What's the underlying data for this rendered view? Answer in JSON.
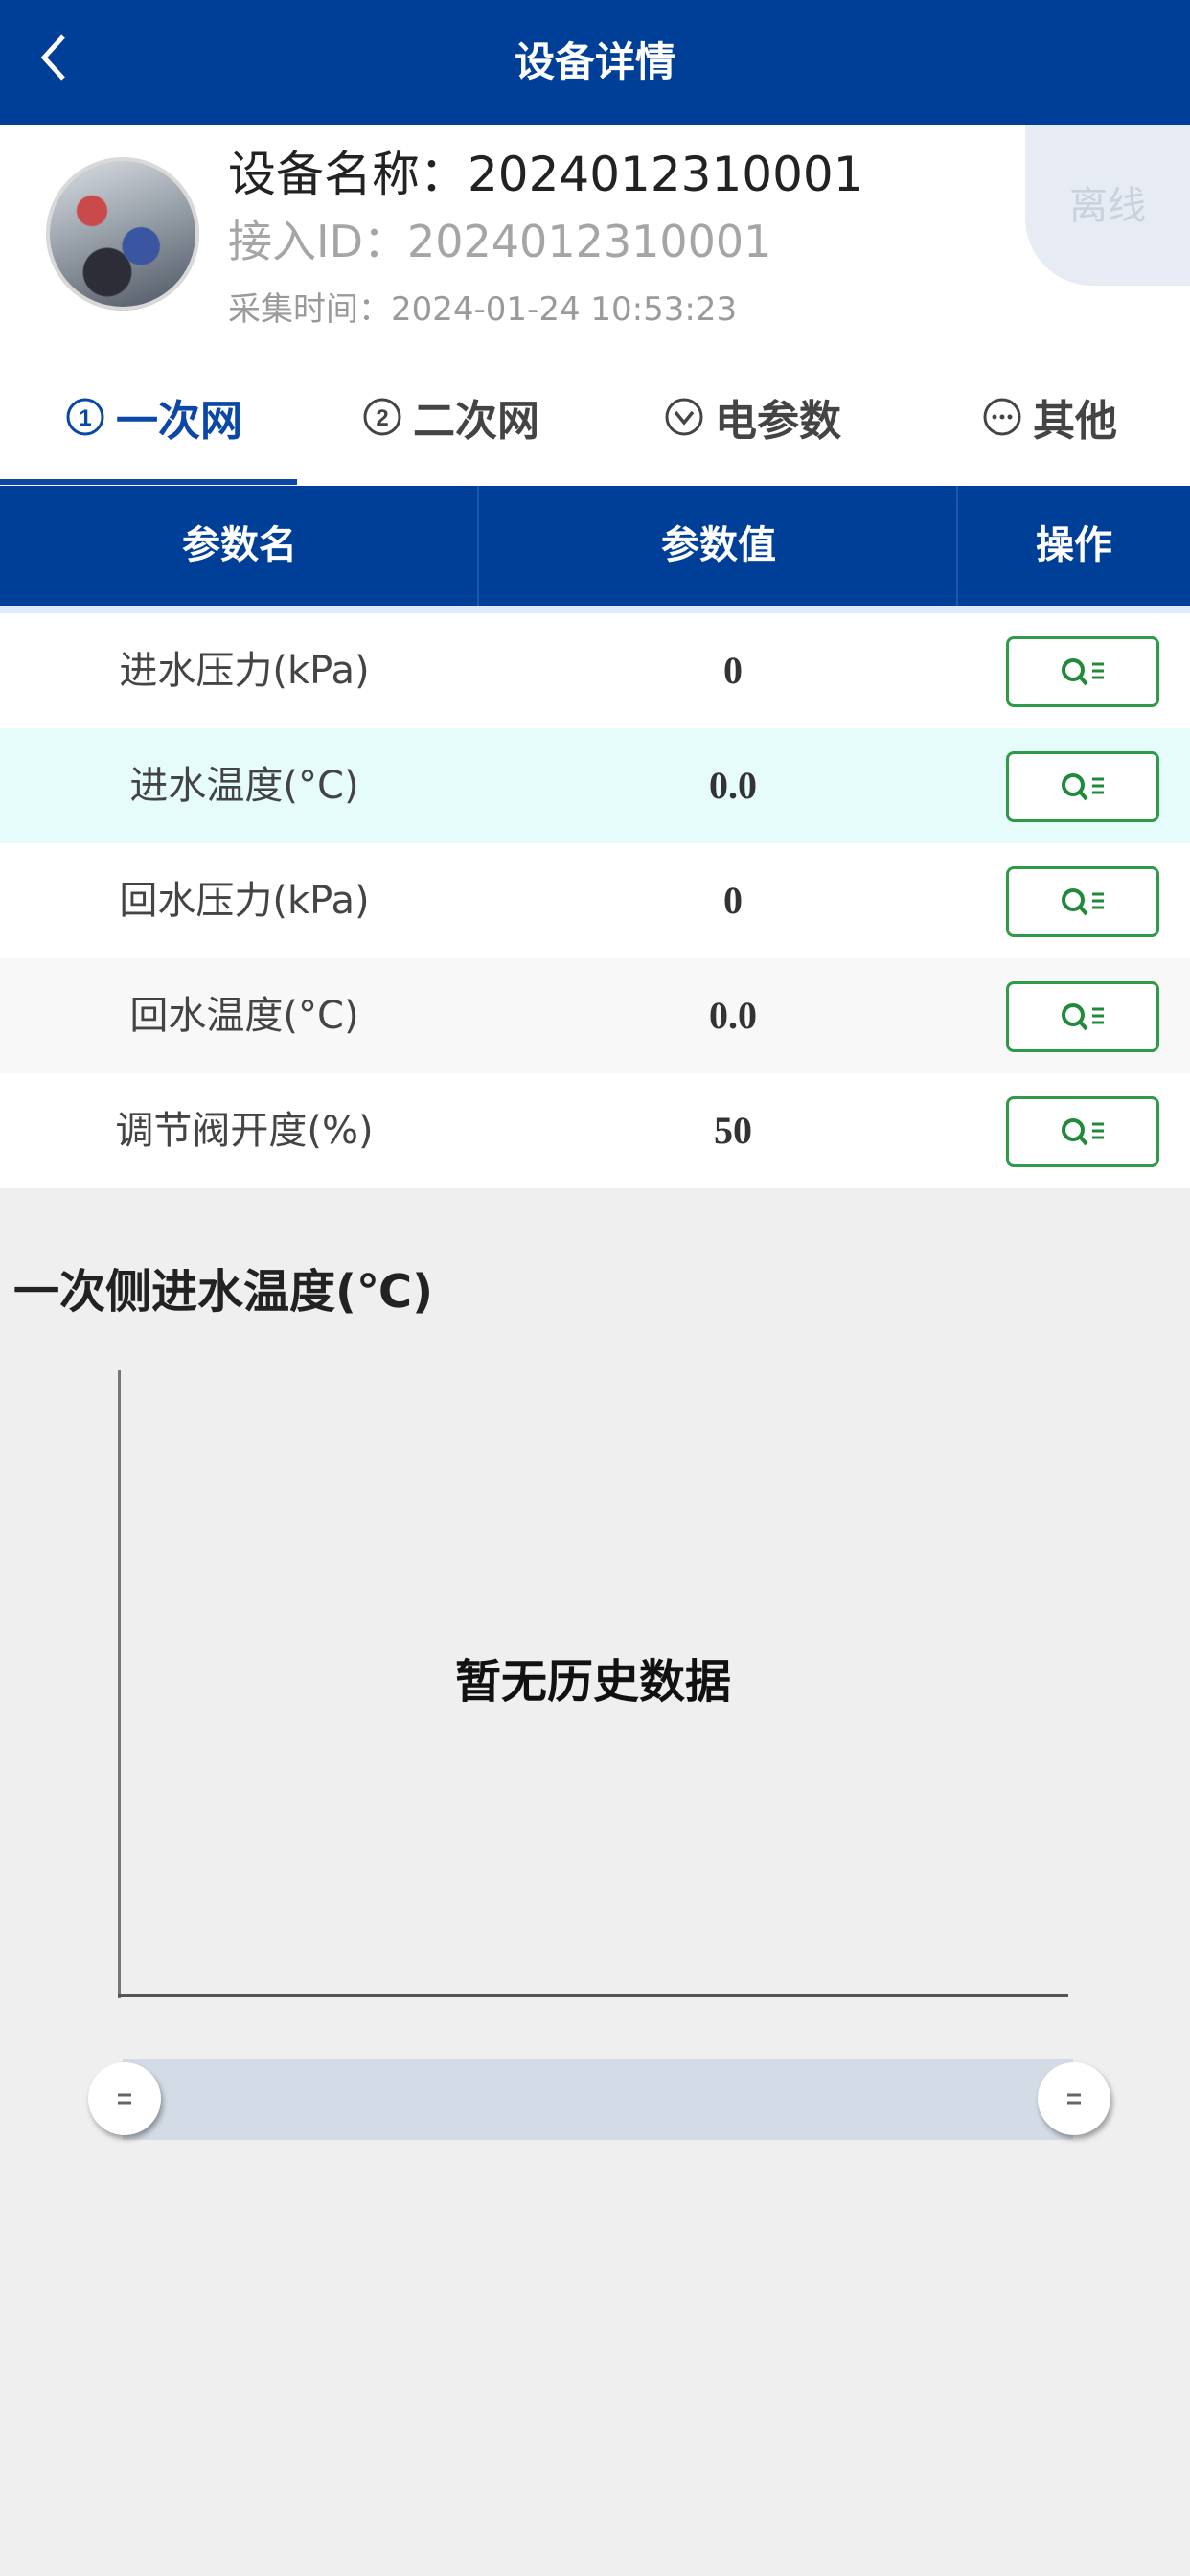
{
  "header": {
    "title": "设备详情",
    "back_icon": "chevron-left-icon"
  },
  "device": {
    "name_line": "设备名称：2024012310001",
    "access_id_line": "接入ID：2024012310001",
    "collect_time_line": "采集时间：2024-01-24 10:53:23",
    "status": "离线"
  },
  "tabs": [
    {
      "label": "一次网",
      "icon": "circled-one-icon",
      "active": true
    },
    {
      "label": "二次网",
      "icon": "circled-two-icon",
      "active": false
    },
    {
      "label": "电参数",
      "icon": "circled-chevron-down-icon",
      "active": false
    },
    {
      "label": "其他",
      "icon": "circled-ellipsis-icon",
      "active": false
    }
  ],
  "table": {
    "headers": [
      "参数名",
      "参数值",
      "操作"
    ],
    "rows": [
      {
        "name": "进水压力(kPa)",
        "value": "0"
      },
      {
        "name": "进水温度(°C)",
        "value": "0.0"
      },
      {
        "name": "回水压力(kPa)",
        "value": "0"
      },
      {
        "name": "回水温度(°C)",
        "value": "0.0"
      },
      {
        "name": "调节阀开度(%)",
        "value": "50"
      }
    ],
    "action_icon": "search-list-icon"
  },
  "chart": {
    "title": "一次侧进水温度(℃)",
    "empty_text": "暂无历史数据"
  },
  "colors": {
    "primary": "#003f97",
    "highlight_row": "#e5fcfb",
    "action_green": "#2f9a47",
    "background": "#efefef"
  },
  "chart_data": {
    "type": "line",
    "title": "一次侧进水温度(℃)",
    "series": [],
    "annotations": [
      "暂无历史数据"
    ]
  }
}
